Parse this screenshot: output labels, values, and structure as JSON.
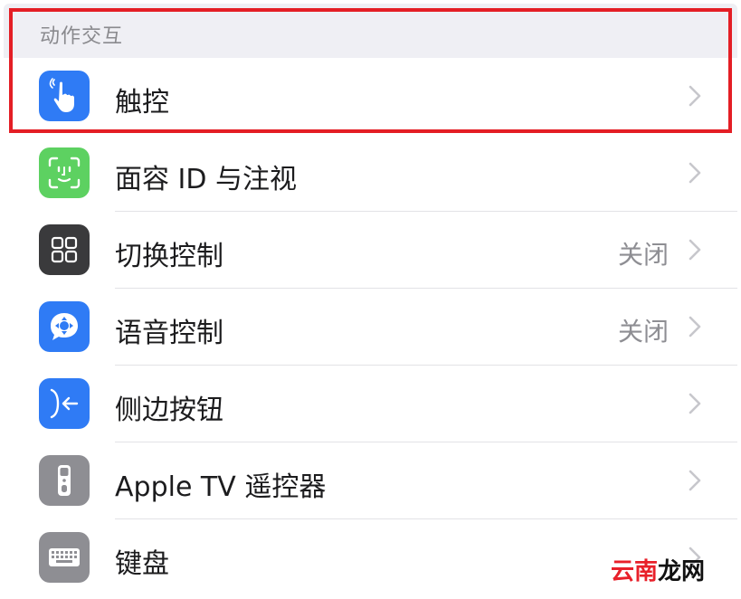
{
  "section": {
    "title": "动作交互"
  },
  "rows": [
    {
      "label": "触控",
      "value": "",
      "icon": "touch-hand-icon",
      "icon_bg": "#2f7bf5"
    },
    {
      "label": "面容 ID 与注视",
      "value": "",
      "icon": "face-id-icon",
      "icon_bg": "#5dd161"
    },
    {
      "label": "切换控制",
      "value": "关闭",
      "icon": "switch-control-icon",
      "icon_bg": "#3a3a3c"
    },
    {
      "label": "语音控制",
      "value": "关闭",
      "icon": "voice-control-icon",
      "icon_bg": "#2f7bf5"
    },
    {
      "label": "侧边按钮",
      "value": "",
      "icon": "side-button-icon",
      "icon_bg": "#2f7bf5"
    },
    {
      "label": "Apple TV 遥控器",
      "value": "",
      "icon": "apple-tv-remote-icon",
      "icon_bg": "#8e8e93"
    },
    {
      "label": "键盘",
      "value": "",
      "icon": "keyboard-icon",
      "icon_bg": "#8e8e93"
    }
  ],
  "watermark": {
    "part1": "云南",
    "part2": "龙网"
  },
  "colors": {
    "highlight": "#e41e25",
    "chevron": "#c7c7cc",
    "header_bg": "#efeff4"
  }
}
